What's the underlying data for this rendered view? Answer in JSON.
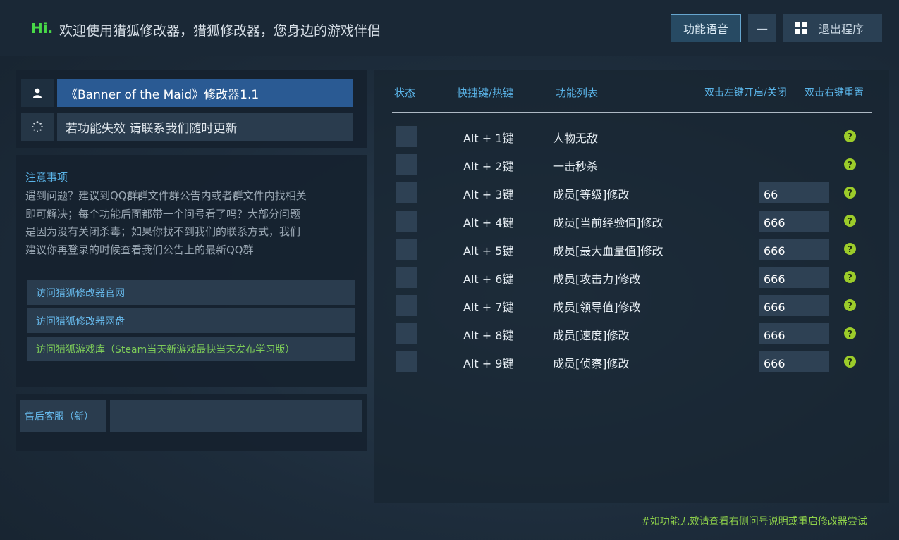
{
  "header": {
    "greeting": "Hi.",
    "welcome": "欢迎使用猎狐修改器，猎狐修改器，您身边的游戏伴侣",
    "voice_button": "功能语音",
    "minimize_label": "—",
    "exit_button": "退出程序"
  },
  "info": {
    "title": "《Banner of the Maid》修改器1.1",
    "update_notice": "若功能失效 请联系我们随时更新"
  },
  "notice": {
    "title": "注意事项",
    "lines": [
      "遇到问题？建议到QQ群群文件群公告内或者群文件内找相关",
      "即可解决；每个功能后面都带一个问号看了吗？大部分问题",
      "是因为没有关闭杀毒；如果你找不到我们的联系方式，我们",
      "建议你再登录的时候查看我们公告上的最新QQ群"
    ]
  },
  "links": [
    "访问猎狐修改器官网",
    "访问猎狐修改器网盘",
    "访问猎狐游戏库（Steam当天新游戏最快当天发布学习版）"
  ],
  "service": {
    "label": "售后客服（新）"
  },
  "table": {
    "headers": {
      "status": "状态",
      "hotkey": "快捷键/热键",
      "features": "功能列表",
      "toggle_hint": "双击左键开启/关闭",
      "reset_hint": "双击右键重置"
    },
    "rows": [
      {
        "key": "Alt + 1键",
        "name": "人物无敌",
        "value": null
      },
      {
        "key": "Alt + 2键",
        "name": "一击秒杀",
        "value": null
      },
      {
        "key": "Alt + 3键",
        "name": "成员[等级]修改",
        "value": "66"
      },
      {
        "key": "Alt + 4键",
        "name": "成员[当前经验值]修改",
        "value": "666"
      },
      {
        "key": "Alt + 5键",
        "name": "成员[最大血量值]修改",
        "value": "666"
      },
      {
        "key": "Alt + 6键",
        "name": "成员[攻击力]修改",
        "value": "666"
      },
      {
        "key": "Alt + 7键",
        "name": "成员[领导值]修改",
        "value": "666"
      },
      {
        "key": "Alt + 8键",
        "name": "成员[速度]修改",
        "value": "666"
      },
      {
        "key": "Alt + 9键",
        "name": "成员[侦察]修改",
        "value": "666"
      }
    ],
    "help_glyph": "?"
  },
  "footer": {
    "note": "#如功能无效请查看右侧问号说明或重启修改器尝试"
  },
  "icons": {
    "user": "user-icon",
    "spinner": "loading-icon",
    "windows": "windows-icon",
    "help": "help-icon"
  },
  "colors": {
    "accent_blue": "#5ab4e8",
    "hi_green": "#48d848",
    "help_green": "#9ccc2a",
    "footer_green": "#8fd24a",
    "title_highlight": "#2a5a93"
  }
}
